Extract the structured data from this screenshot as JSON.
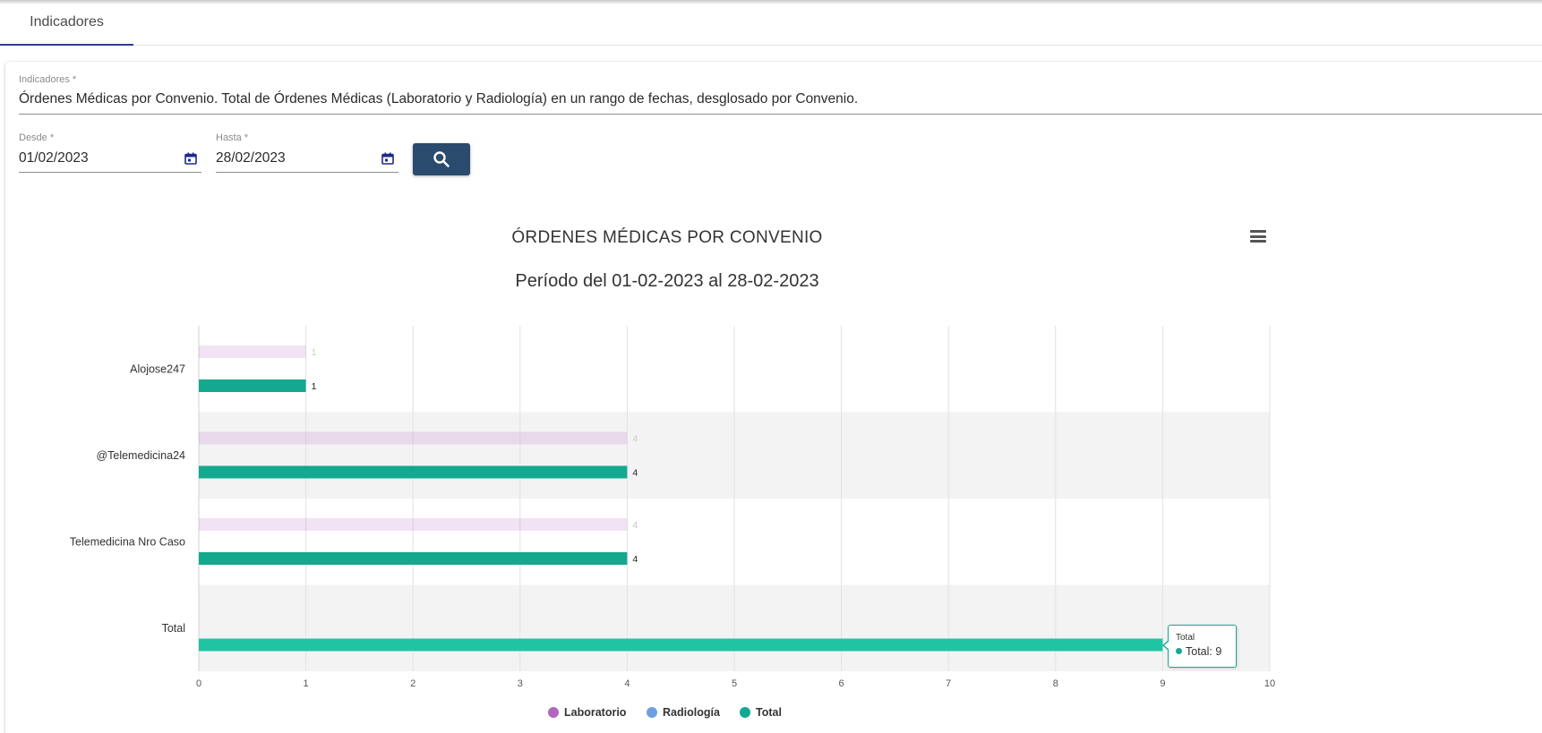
{
  "tabs": [
    {
      "label": "Indicadores"
    }
  ],
  "form": {
    "indicator_label": "Indicadores *",
    "indicator_value": "Órdenes Médicas por Convenio. Total de Órdenes Médicas (Laboratorio y Radiología) en un rango de fechas, desglosado por Convenio.",
    "from_label": "Desde *",
    "from_value": "01/02/2023",
    "to_label": "Hasta *",
    "to_value": "28/02/2023",
    "search_icon": "search-icon",
    "calendar_icon": "calendar-icon"
  },
  "chart_data": {
    "type": "bar",
    "orientation": "horizontal",
    "title": "ÓRDENES MÉDICAS POR CONVENIO",
    "subtitle": "Período del 01-02-2023 al 28-02-2023",
    "categories": [
      "Alojose247",
      "@Telemedicina24",
      "Telemedicina Nro Caso",
      "Total"
    ],
    "series": [
      {
        "name": "Laboratorio",
        "color": "#b266c0",
        "values": [
          1,
          4,
          4,
          null
        ],
        "dimmed": true
      },
      {
        "name": "Radiología",
        "color": "#6ea0e0",
        "values": [
          null,
          null,
          null,
          null
        ]
      },
      {
        "name": "Total",
        "color": "#13a98f",
        "values": [
          1,
          4,
          4,
          9
        ]
      }
    ],
    "x_ticks": [
      "0",
      "1",
      "2",
      "3",
      "4",
      "5",
      "6",
      "7",
      "8",
      "9",
      "10"
    ],
    "xlim": [
      0,
      10
    ],
    "grid": true,
    "legend_position": "bottom"
  },
  "tooltip": {
    "title": "Total",
    "line": "Total: 9"
  },
  "menu_icon": "hamburger-menu-icon"
}
